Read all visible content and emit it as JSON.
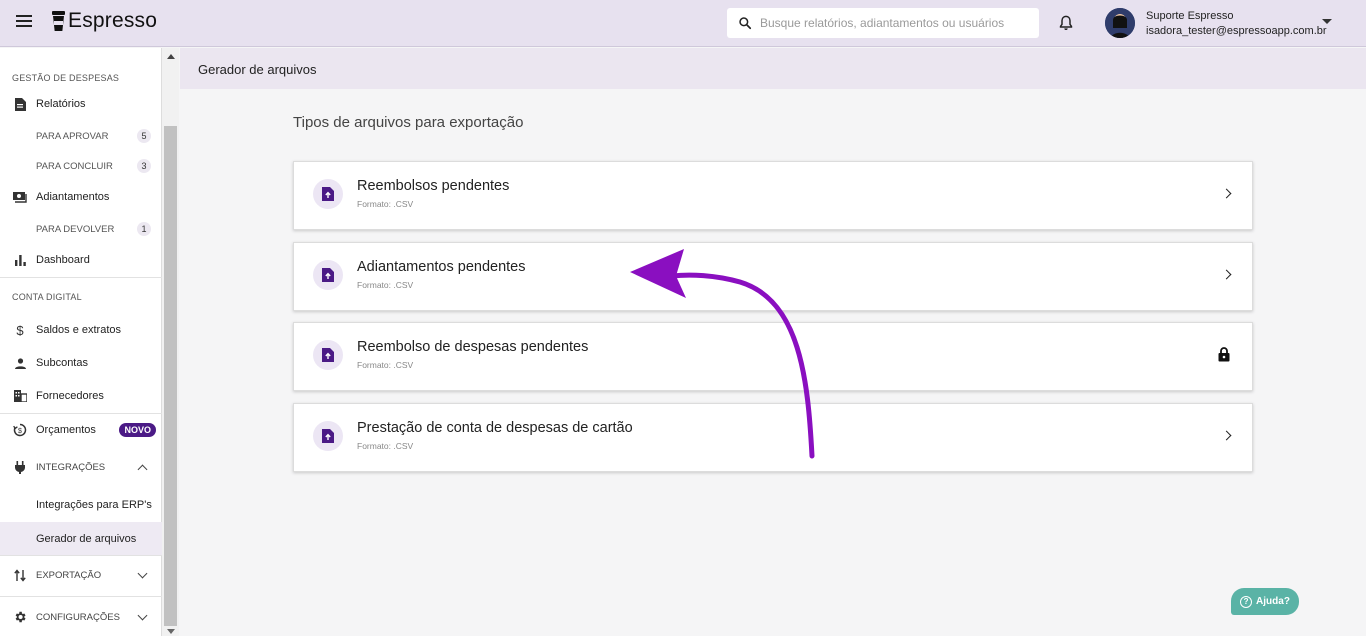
{
  "app": {
    "brand": "Espresso"
  },
  "search": {
    "placeholder": "Busque relatórios, adiantamentos ou usuários"
  },
  "user": {
    "name": "Suporte Espresso",
    "email": "isadora_tester@espressoapp.com.br"
  },
  "sidebar": {
    "gestao_title": "GESTÃO DE DESPESAS",
    "relatorios": "Relatórios",
    "para_aprovar": {
      "label": "PARA APROVAR",
      "count": "5"
    },
    "para_concluir": {
      "label": "PARA CONCLUIR",
      "count": "3"
    },
    "adiantamentos": "Adiantamentos",
    "para_devolver": {
      "label": "PARA DEVOLVER",
      "count": "1"
    },
    "dashboard": "Dashboard",
    "conta_title": "CONTA DIGITAL",
    "saldos": "Saldos e extratos",
    "subcontas": "Subcontas",
    "fornecedores": "Fornecedores",
    "orcamentos": "Orçamentos",
    "novo_badge": "NOVO",
    "integracoes": "INTEGRAÇÕES",
    "integracoes_erp": "Integrações para ERP's",
    "gerador": "Gerador de arquivos",
    "exportacao": "EXPORTAÇÃO",
    "configuracoes": "CONFIGURAÇÕES"
  },
  "page": {
    "header": "Gerador de arquivos",
    "section_title": "Tipos de arquivos para exportação"
  },
  "cards": [
    {
      "title": "Reembolsos pendentes",
      "format": "Formato: .CSV",
      "locked": false
    },
    {
      "title": "Adiantamentos pendentes",
      "format": "Formato: .CSV",
      "locked": false
    },
    {
      "title": "Reembolso de despesas pendentes",
      "format": "Formato: .CSV",
      "locked": true
    },
    {
      "title": "Prestação de conta de despesas de cartão",
      "format": "Formato: .CSV",
      "locked": false
    }
  ],
  "colors": {
    "accent": "#4b1a86",
    "annotation_arrow": "#8a0fc0",
    "help": "#5ab3a6",
    "topbar": "#e7e1ef"
  },
  "help": {
    "label": "Ajuda?"
  }
}
